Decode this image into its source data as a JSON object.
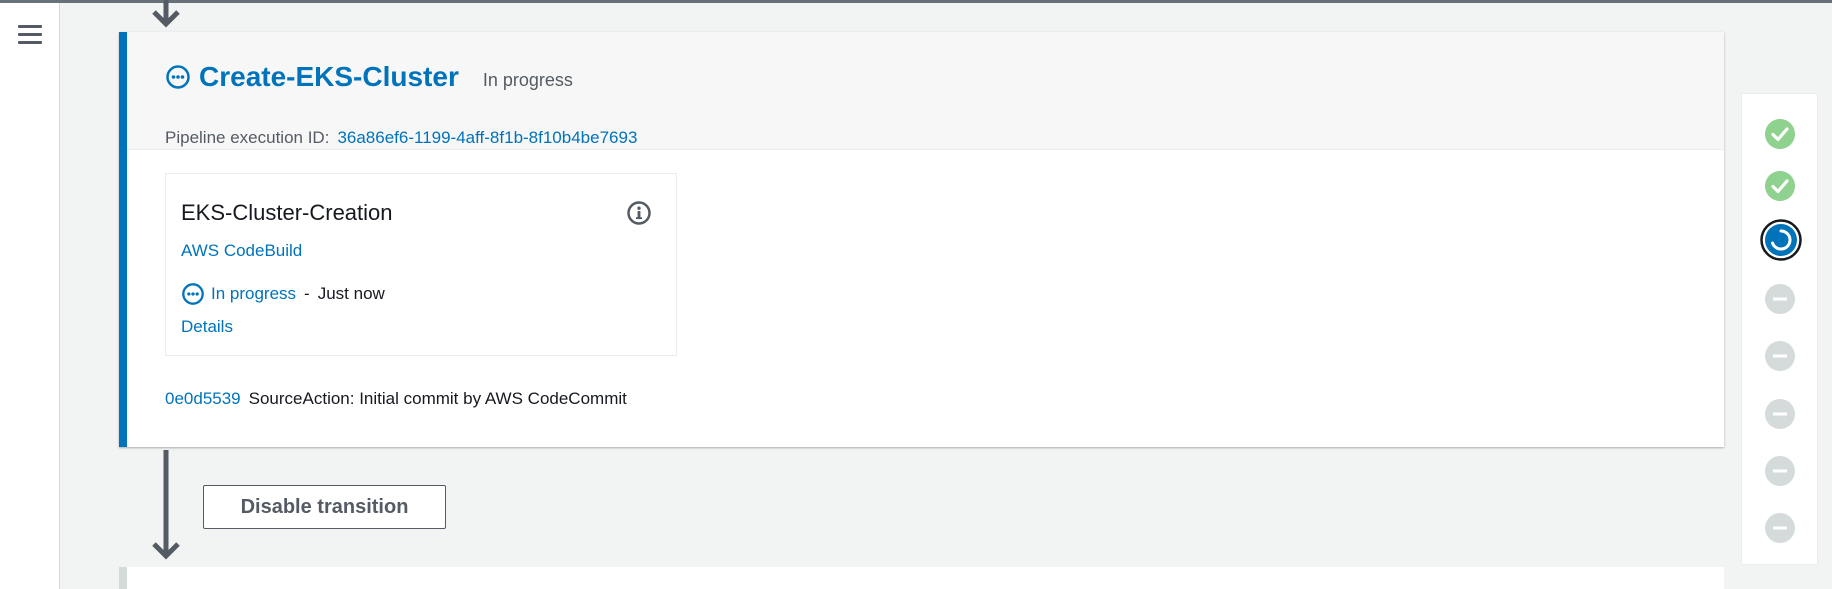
{
  "nav": {
    "menu_icon": "hamburger-menu-icon"
  },
  "stage": {
    "name": "Create-EKS-Cluster",
    "status": "In progress",
    "status_icon": "in-progress-icon",
    "execution_id_label": "Pipeline execution ID:",
    "execution_id": "36a86ef6-1199-4aff-8f1b-8f10b4be7693",
    "action": {
      "name": "EKS-Cluster-Creation",
      "provider": "AWS CodeBuild",
      "status": "In progress",
      "separator": "-",
      "time": "Just now",
      "details_label": "Details",
      "info_icon": "info-icon"
    },
    "commit": {
      "hash": "0e0d5539",
      "message": "SourceAction: Initial commit by AWS CodeCommit"
    }
  },
  "transition": {
    "button_label": "Disable transition"
  },
  "stage_progress": [
    "succeeded",
    "succeeded",
    "in-progress",
    "not-started",
    "not-started",
    "not-started",
    "not-started",
    "not-started"
  ],
  "colors": {
    "accent": "#0073bb",
    "success": "#8fd18f",
    "pending": "#d5dbdb",
    "text_secondary": "#545b64"
  }
}
